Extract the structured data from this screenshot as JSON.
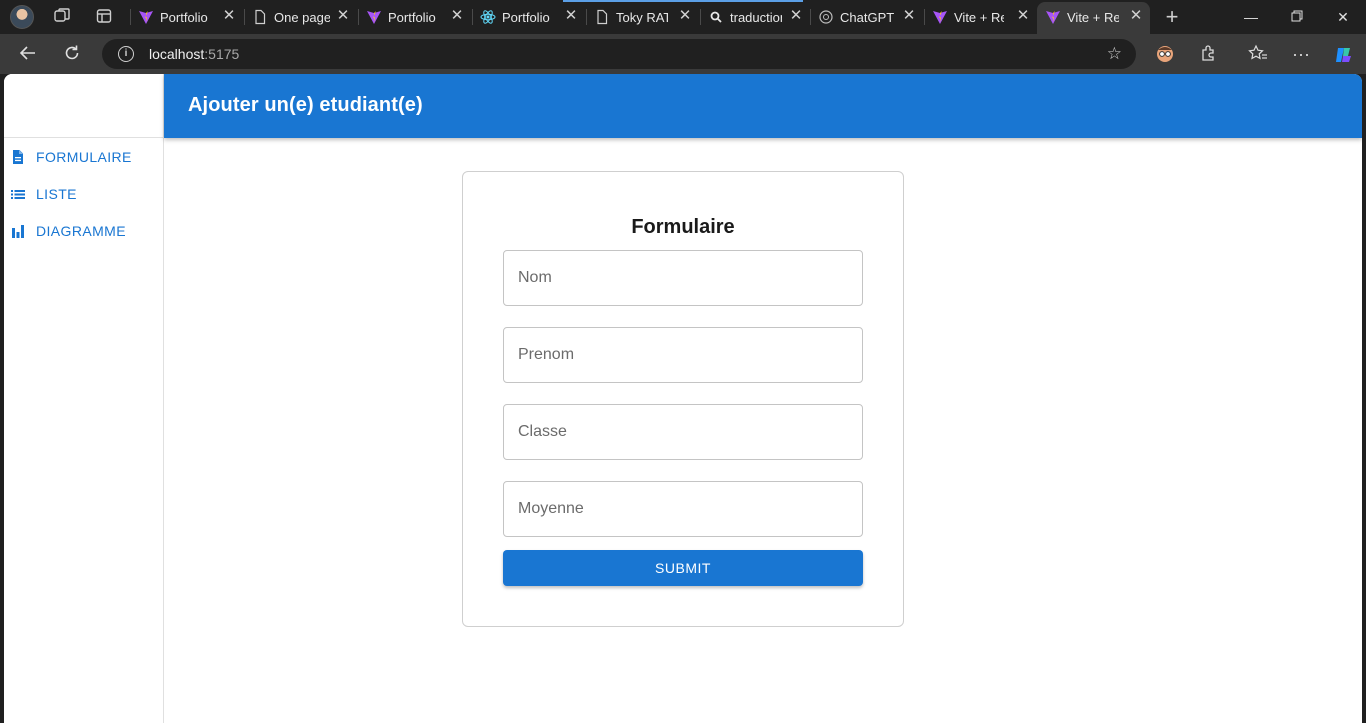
{
  "browser": {
    "tabs": [
      {
        "title": "Portfolio |",
        "icon": "vite-icon"
      },
      {
        "title": "One page",
        "icon": "page-icon"
      },
      {
        "title": "Portfolio |",
        "icon": "vite-icon"
      },
      {
        "title": "Portfolio |",
        "icon": "react-icon"
      },
      {
        "title": "Toky RATO",
        "icon": "page-icon"
      },
      {
        "title": "traduction",
        "icon": "search-icon"
      },
      {
        "title": "ChatGPT",
        "icon": "chatgpt-icon"
      },
      {
        "title": "Vite + Rea",
        "icon": "vite-icon"
      },
      {
        "title": "Vite + Rea",
        "icon": "vite-icon",
        "active": true
      }
    ],
    "url_host": "localhost",
    "url_port": ":5175"
  },
  "app": {
    "title": "Ajouter un(e) etudiant(e)",
    "accent_color": "#1976d2"
  },
  "sidebar": {
    "items": [
      {
        "label": "FORMULAIRE",
        "icon": "document-icon"
      },
      {
        "label": "LISTE",
        "icon": "list-icon"
      },
      {
        "label": "DIAGRAMME",
        "icon": "bar-chart-icon"
      }
    ]
  },
  "form": {
    "title": "Formulaire",
    "fields": [
      {
        "placeholder": "Nom",
        "value": ""
      },
      {
        "placeholder": "Prenom",
        "value": ""
      },
      {
        "placeholder": "Classe",
        "value": ""
      },
      {
        "placeholder": "Moyenne",
        "value": ""
      }
    ],
    "submit_label": "SUBMIT"
  }
}
